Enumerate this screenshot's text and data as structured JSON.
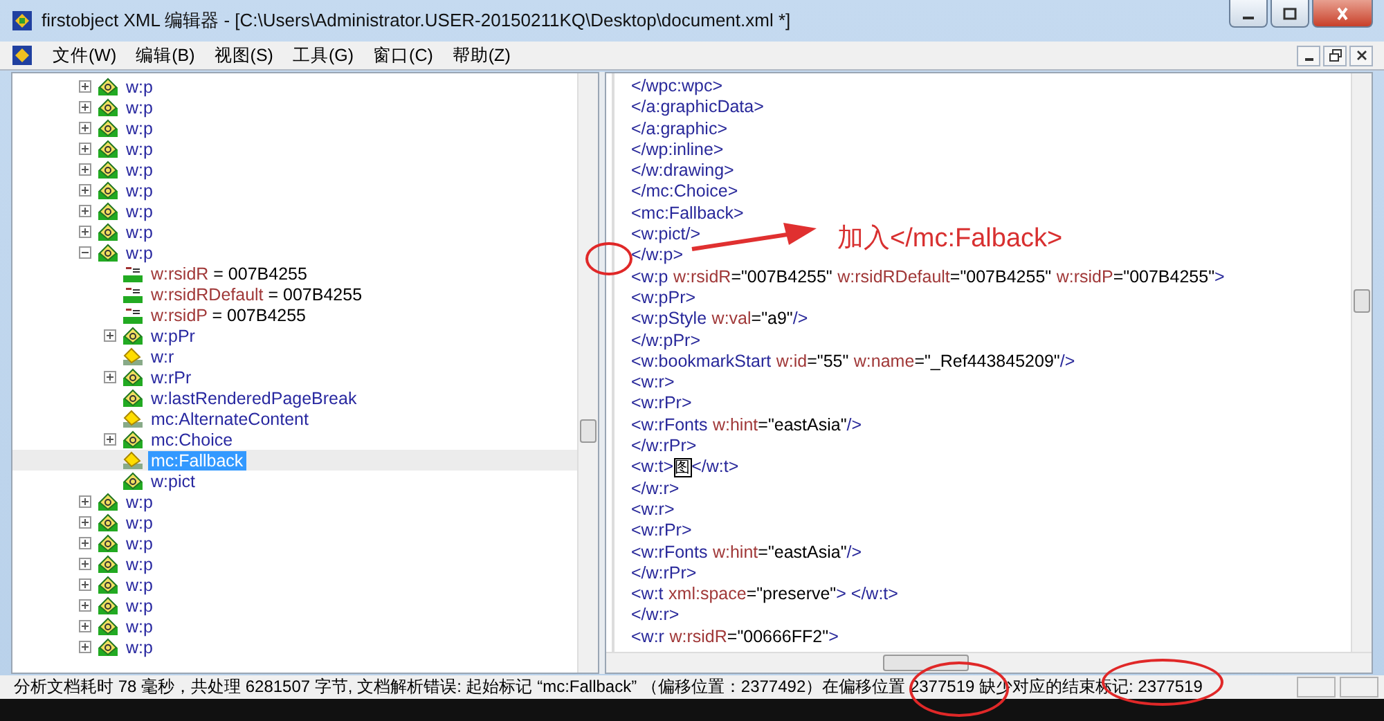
{
  "window": {
    "title": "firstobject XML 编辑器 - [C:\\Users\\Administrator.USER-20150211KQ\\Desktop\\document.xml *]"
  },
  "menu": [
    "文件(W)",
    "编辑(B)",
    "视图(S)",
    "工具(G)",
    "窗口(C)",
    "帮助(Z)"
  ],
  "tree": [
    {
      "kind": "element",
      "label": "w:p",
      "expanded": false,
      "selected": false
    },
    {
      "kind": "element",
      "label": "w:p",
      "expanded": false,
      "selected": false
    },
    {
      "kind": "element",
      "label": "w:p",
      "expanded": false,
      "selected": false
    },
    {
      "kind": "element",
      "label": "w:p",
      "expanded": false,
      "selected": false
    },
    {
      "kind": "element",
      "label": "w:p",
      "expanded": false,
      "selected": false
    },
    {
      "kind": "element",
      "label": "w:p",
      "expanded": false,
      "selected": false
    },
    {
      "kind": "element",
      "label": "w:p",
      "expanded": false,
      "selected": false
    },
    {
      "kind": "element",
      "label": "w:p",
      "expanded": false,
      "selected": false
    },
    {
      "kind": "element",
      "label": "w:p",
      "expanded": true,
      "selected": false,
      "children": [
        {
          "kind": "attribute",
          "label": "w:rsidR",
          "value": "= 007B4255",
          "selected": false
        },
        {
          "kind": "attribute",
          "label": "w:rsidRDefault",
          "value": "= 007B4255",
          "selected": false
        },
        {
          "kind": "attribute",
          "label": "w:rsidP",
          "value": "= 007B4255",
          "selected": false
        },
        {
          "kind": "element",
          "label": "w:pPr",
          "expanded": false,
          "selected": false
        },
        {
          "kind": "text-element",
          "label": "w:r",
          "selected": false
        },
        {
          "kind": "element",
          "label": "w:rPr",
          "expanded": false,
          "selected": false
        },
        {
          "kind": "empty-element",
          "label": "w:lastRenderedPageBreak",
          "selected": false
        },
        {
          "kind": "text-element",
          "label": "mc:AlternateContent",
          "selected": false
        },
        {
          "kind": "element",
          "label": "mc:Choice",
          "expanded": false,
          "selected": false
        },
        {
          "kind": "text-element",
          "label": "mc:Fallback",
          "selected": true
        },
        {
          "kind": "empty-element",
          "label": "w:pict",
          "selected": false
        }
      ]
    },
    {
      "kind": "element",
      "label": "w:p",
      "expanded": false,
      "selected": false
    },
    {
      "kind": "element",
      "label": "w:p",
      "expanded": false,
      "selected": false
    },
    {
      "kind": "element",
      "label": "w:p",
      "expanded": false,
      "selected": false
    },
    {
      "kind": "element",
      "label": "w:p",
      "expanded": false,
      "selected": false
    },
    {
      "kind": "element",
      "label": "w:p",
      "expanded": false,
      "selected": false
    },
    {
      "kind": "element",
      "label": "w:p",
      "expanded": false,
      "selected": false
    },
    {
      "kind": "element",
      "label": "w:p",
      "expanded": false,
      "selected": false
    },
    {
      "kind": "element",
      "label": "w:p",
      "expanded": false,
      "selected": false
    }
  ],
  "code_lines": [
    [
      {
        "kind": "tag",
        "text": "</wpc:wpc>"
      }
    ],
    [
      {
        "kind": "tag",
        "text": "</a:graphicData>"
      }
    ],
    [
      {
        "kind": "tag",
        "text": "</a:graphic>"
      }
    ],
    [
      {
        "kind": "tag",
        "text": "</wp:inline>"
      }
    ],
    [
      {
        "kind": "tag",
        "text": "</w:drawing>"
      }
    ],
    [
      {
        "kind": "tag",
        "text": "</mc:Choice>"
      }
    ],
    [
      {
        "kind": "tag",
        "text": "<mc:Fallback>"
      }
    ],
    [
      {
        "kind": "tag",
        "text": "<w:pict/>"
      }
    ],
    [
      {
        "kind": "tag",
        "text": "</w:p>"
      }
    ],
    [
      {
        "kind": "tag",
        "text": "<w:p"
      },
      {
        "kind": "attr",
        "text": "w:rsidR"
      },
      {
        "kind": "value",
        "text": "=\"007B4255\""
      },
      {
        "kind": "attr",
        "text": "w:rsidRDefault"
      },
      {
        "kind": "value",
        "text": "=\"007B4255\""
      },
      {
        "kind": "attr",
        "text": "w:rsidP"
      },
      {
        "kind": "value",
        "text": "=\"007B4255\""
      },
      {
        "kind": "tag",
        "text": ">"
      }
    ],
    [
      {
        "kind": "tag",
        "text": "<w:pPr>"
      }
    ],
    [
      {
        "kind": "tag",
        "text": "<w:pStyle"
      },
      {
        "kind": "attr",
        "text": "w:val"
      },
      {
        "kind": "value",
        "text": "=\"a9\""
      },
      {
        "kind": "tag",
        "text": "/>"
      }
    ],
    [
      {
        "kind": "tag",
        "text": "</w:pPr>"
      }
    ],
    [
      {
        "kind": "tag",
        "text": "<w:bookmarkStart"
      },
      {
        "kind": "attr",
        "text": "w:id"
      },
      {
        "kind": "value",
        "text": "=\"55\""
      },
      {
        "kind": "attr",
        "text": "w:name"
      },
      {
        "kind": "value",
        "text": "=\"_Ref443845209\""
      },
      {
        "kind": "tag",
        "text": "/>"
      }
    ],
    [
      {
        "kind": "tag",
        "text": "<w:r>"
      }
    ],
    [
      {
        "kind": "tag",
        "text": "<w:rPr>"
      }
    ],
    [
      {
        "kind": "tag",
        "text": "<w:rFonts"
      },
      {
        "kind": "attr",
        "text": "w:hint"
      },
      {
        "kind": "value",
        "text": "=\"eastAsia\""
      },
      {
        "kind": "tag",
        "text": "/>"
      }
    ],
    [
      {
        "kind": "tag",
        "text": "</w:rPr>"
      }
    ],
    [
      {
        "kind": "tag",
        "text": "<w:t>"
      },
      {
        "kind": "boxed",
        "text": "图"
      },
      {
        "kind": "tag",
        "text": "</w:t>"
      }
    ],
    [
      {
        "kind": "tag",
        "text": "</w:r>"
      }
    ],
    [
      {
        "kind": "tag",
        "text": "<w:r>"
      }
    ],
    [
      {
        "kind": "tag",
        "text": "<w:rPr>"
      }
    ],
    [
      {
        "kind": "tag",
        "text": "<w:rFonts"
      },
      {
        "kind": "attr",
        "text": "w:hint"
      },
      {
        "kind": "value",
        "text": "=\"eastAsia\""
      },
      {
        "kind": "tag",
        "text": "/>"
      }
    ],
    [
      {
        "kind": "tag",
        "text": "</w:rPr>"
      }
    ],
    [
      {
        "kind": "tag",
        "text": "<w:t"
      },
      {
        "kind": "attr",
        "text": "xml:space"
      },
      {
        "kind": "value",
        "text": "=\"preserve\""
      },
      {
        "kind": "tag",
        "text": "> </w:t>"
      }
    ],
    [
      {
        "kind": "tag",
        "text": "</w:r>"
      }
    ],
    [
      {
        "kind": "tag",
        "text": "<w:r"
      },
      {
        "kind": "attr",
        "text": "w:rsidR"
      },
      {
        "kind": "value",
        "text": "=\"00666FF2\""
      },
      {
        "kind": "tag",
        "text": ">"
      }
    ]
  ],
  "annotation": {
    "text": "加入</mc:Falback>"
  },
  "status_bar": {
    "text": "分析文档耗时 78 毫秒，共处理 6281507 字节, 文档解析错误: 起始标记 “mc:Fallback” （偏移位置：2377492）在偏移位置 2377519 缺少对应的结束标记: 2377519"
  }
}
